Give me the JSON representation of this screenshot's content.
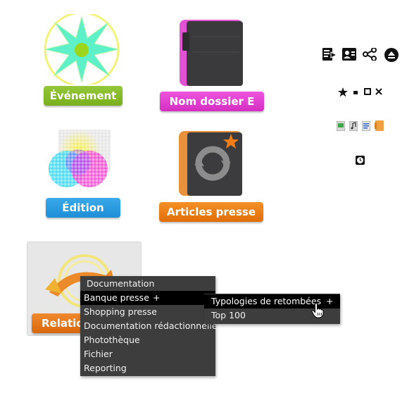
{
  "tiles": {
    "evenement": {
      "label": "Événement"
    },
    "nom_dossier": {
      "label": "Nom dossier E"
    },
    "edition": {
      "label": "Édition"
    },
    "articles_presse": {
      "label": "Articles presse"
    },
    "relations": {
      "label": "Relatio"
    }
  },
  "toolbar_icons": {
    "row1": [
      "export-list-icon",
      "contact-card-icon",
      "share-icon",
      "eject-icon"
    ],
    "row2": [
      "star-icon",
      "minimize-icon",
      "maximize-icon",
      "close-icon"
    ],
    "row3": [
      "spreadsheet-file-icon",
      "audio-file-icon",
      "document-file-icon",
      "folder-icon"
    ],
    "row4": [
      "clock-icon"
    ]
  },
  "context_menu": {
    "items": [
      {
        "label": "Documentation"
      },
      {
        "label": "Banque presse",
        "submenu_marker": "+"
      },
      {
        "label": "Shopping presse"
      },
      {
        "label": "Documentation rédactionnelle"
      },
      {
        "label": "Photothèque"
      },
      {
        "label": "Fichier"
      },
      {
        "label": "Reporting"
      }
    ],
    "active_index": 1
  },
  "submenu": {
    "items": [
      {
        "label": "Typologies de retombées",
        "submenu_marker": "+"
      },
      {
        "label": "Top 100"
      }
    ],
    "active_index": 0
  },
  "colors": {
    "evenement": "#86bc28",
    "nom_dossier": "#e03fd0",
    "edition": "#2a9be0",
    "articles_presse": "#ec7d14",
    "relations": "#e07418",
    "menu_bg": "#3d3d3d",
    "menu_active": "#000000"
  }
}
